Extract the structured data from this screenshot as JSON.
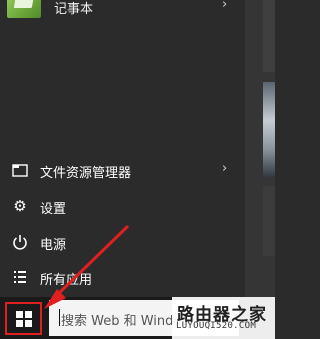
{
  "start_menu": {
    "top_app": {
      "label": "记事本",
      "icon": "notepad-icon"
    },
    "items": [
      {
        "label": "文件资源管理器",
        "icon": "folder-icon",
        "has_submenu": true
      },
      {
        "label": "设置",
        "icon": "gear-icon",
        "has_submenu": false
      },
      {
        "label": "电源",
        "icon": "power-icon",
        "has_submenu": false
      },
      {
        "label": "所有应用",
        "icon": "list-icon",
        "has_submenu": false
      }
    ]
  },
  "taskbar": {
    "start_icon": "windows-logo-icon",
    "search_text": "搜索 Web 和 Windows"
  },
  "watermark": {
    "title": "路由器之家",
    "url": "LUYOUQI520.COM"
  },
  "annotation": {
    "color": "#e02020"
  }
}
